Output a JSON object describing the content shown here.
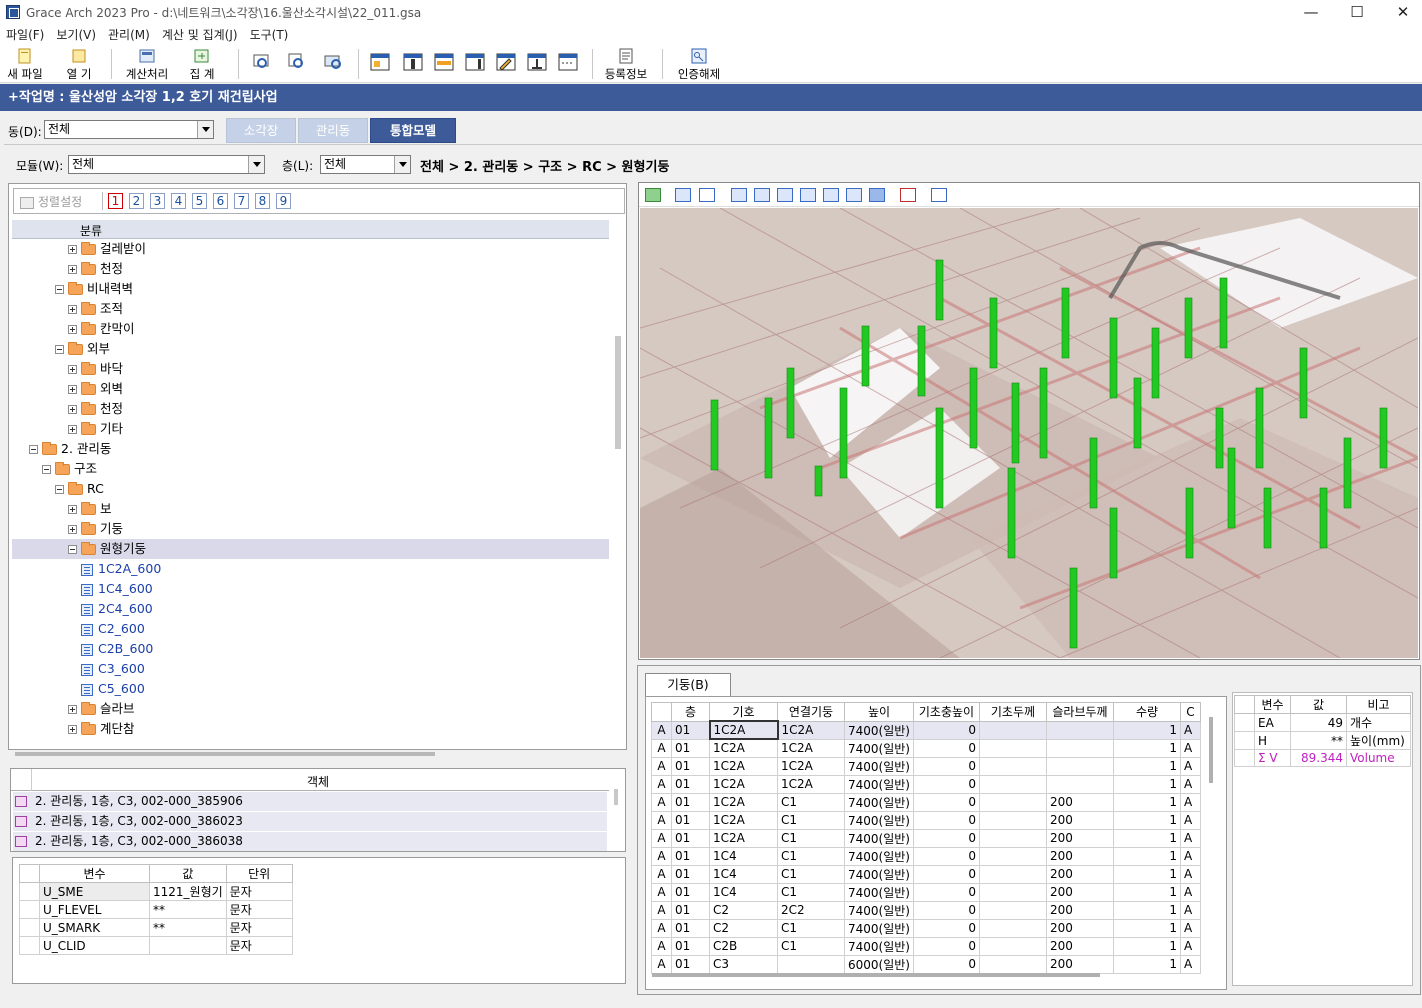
{
  "app": {
    "title": "Grace Arch 2023 Pro - d:\\네트워크\\소각장\\16.울산소각시설\\22_011.gsa"
  },
  "window": {
    "minimize": "—",
    "maximize": "☐",
    "close": "✕"
  },
  "menu": [
    "파일(F)",
    "보기(V)",
    "관리(M)",
    "계산 및 집계(J)",
    "도구(T)"
  ],
  "toolbar": {
    "new": "새 파일",
    "open": "열  기",
    "calc": "계산처리",
    "aggregate": "집  계",
    "register": "등록정보",
    "unauth": "인증해제"
  },
  "project": {
    "title": "+작업명 : 울산성암 소각장 1,2 호기 재건립사업"
  },
  "building": {
    "label": "동(D):",
    "value": "전체"
  },
  "tabs": [
    "소각장",
    "관리동",
    "통합모델"
  ],
  "module": {
    "label": "모듈(W):",
    "value": "전체"
  },
  "floor": {
    "label": "층(L):",
    "value": "전체"
  },
  "breadcrumb": "전체 > 2. 관리동 > 구조 > RC > 원형기둥",
  "sort": {
    "label": "정렬설정",
    "levels": [
      "1",
      "2",
      "3",
      "4",
      "5",
      "6",
      "7",
      "8",
      "9"
    ]
  },
  "tree": {
    "header": "분류",
    "rows": [
      {
        "label": "걸레받이",
        "depth": 4,
        "type": "folder",
        "exp": "plus"
      },
      {
        "label": "천정",
        "depth": 4,
        "type": "folder",
        "exp": "plus"
      },
      {
        "label": "비내력벽",
        "depth": 3,
        "type": "folder",
        "exp": "minus"
      },
      {
        "label": "조적",
        "depth": 4,
        "type": "folder",
        "exp": "plus"
      },
      {
        "label": "칸막이",
        "depth": 4,
        "type": "folder",
        "exp": "plus"
      },
      {
        "label": "외부",
        "depth": 3,
        "type": "folder",
        "exp": "minus"
      },
      {
        "label": "바닥",
        "depth": 4,
        "type": "folder",
        "exp": "plus"
      },
      {
        "label": "외벽",
        "depth": 4,
        "type": "folder",
        "exp": "plus"
      },
      {
        "label": "천정",
        "depth": 4,
        "type": "folder",
        "exp": "plus"
      },
      {
        "label": "기타",
        "depth": 4,
        "type": "folder",
        "exp": "plus"
      },
      {
        "label": "2. 관리동",
        "depth": 1,
        "type": "folder",
        "exp": "minus"
      },
      {
        "label": "구조",
        "depth": 2,
        "type": "folder",
        "exp": "minus"
      },
      {
        "label": "RC",
        "depth": 3,
        "type": "folder",
        "exp": "minus"
      },
      {
        "label": "보",
        "depth": 4,
        "type": "folder",
        "exp": "plus"
      },
      {
        "label": "기둥",
        "depth": 4,
        "type": "folder",
        "exp": "plus"
      },
      {
        "label": "원형기둥",
        "depth": 4,
        "type": "folder",
        "exp": "minus",
        "selected": true
      },
      {
        "label": "1C2A_600",
        "depth": 5,
        "type": "leaf"
      },
      {
        "label": "1C4_600",
        "depth": 5,
        "type": "leaf"
      },
      {
        "label": "2C4_600",
        "depth": 5,
        "type": "leaf"
      },
      {
        "label": "C2_600",
        "depth": 5,
        "type": "leaf"
      },
      {
        "label": "C2B_600",
        "depth": 5,
        "type": "leaf"
      },
      {
        "label": "C3_600",
        "depth": 5,
        "type": "leaf"
      },
      {
        "label": "C5_600",
        "depth": 5,
        "type": "leaf"
      },
      {
        "label": "슬라브",
        "depth": 4,
        "type": "folder",
        "exp": "plus"
      },
      {
        "label": "계단참",
        "depth": 4,
        "type": "folder",
        "exp": "plus"
      }
    ]
  },
  "objects": {
    "header": "객체",
    "rows": [
      "2. 관리동, 1층, C3, 002-000_385906",
      "2. 관리동, 1층, C3, 002-000_386023",
      "2. 관리동, 1층, C3, 002-000_386038"
    ]
  },
  "vars": {
    "headers": [
      "변수",
      "값",
      "단위"
    ],
    "rows": [
      [
        "U_SME",
        "1121_원형기",
        "문자"
      ],
      [
        "U_FLEVEL",
        "**",
        "문자"
      ],
      [
        "U_SMARK",
        "**",
        "문자"
      ],
      [
        "U_CLID",
        "",
        "문자"
      ]
    ]
  },
  "column_tab": "기둥(B)",
  "column_table": {
    "headers": [
      "",
      "층",
      "기호",
      "연결기둥",
      "높이",
      "기초충높이",
      "기초두께",
      "슬라브두께",
      "수량",
      "C"
    ],
    "rows": [
      [
        "A",
        "01",
        "1C2A",
        "1C2A",
        "7400(일반)",
        "0",
        "",
        "",
        "1",
        "A"
      ],
      [
        "A",
        "01",
        "1C2A",
        "1C2A",
        "7400(일반)",
        "0",
        "",
        "",
        "1",
        "A"
      ],
      [
        "A",
        "01",
        "1C2A",
        "1C2A",
        "7400(일반)",
        "0",
        "",
        "",
        "1",
        "A"
      ],
      [
        "A",
        "01",
        "1C2A",
        "1C2A",
        "7400(일반)",
        "0",
        "",
        "",
        "1",
        "A"
      ],
      [
        "A",
        "01",
        "1C2A",
        "C1",
        "7400(일반)",
        "0",
        "",
        "200",
        "1",
        "A"
      ],
      [
        "A",
        "01",
        "1C2A",
        "C1",
        "7400(일반)",
        "0",
        "",
        "200",
        "1",
        "A"
      ],
      [
        "A",
        "01",
        "1C2A",
        "C1",
        "7400(일반)",
        "0",
        "",
        "200",
        "1",
        "A"
      ],
      [
        "A",
        "01",
        "1C4",
        "C1",
        "7400(일반)",
        "0",
        "",
        "200",
        "1",
        "A"
      ],
      [
        "A",
        "01",
        "1C4",
        "C1",
        "7400(일반)",
        "0",
        "",
        "200",
        "1",
        "A"
      ],
      [
        "A",
        "01",
        "1C4",
        "C1",
        "7400(일반)",
        "0",
        "",
        "200",
        "1",
        "A"
      ],
      [
        "A",
        "01",
        "C2",
        "2C2",
        "7400(일반)",
        "0",
        "",
        "200",
        "1",
        "A"
      ],
      [
        "A",
        "01",
        "C2",
        "C1",
        "7400(일반)",
        "0",
        "",
        "200",
        "1",
        "A"
      ],
      [
        "A",
        "01",
        "C2B",
        "C1",
        "7400(일반)",
        "0",
        "",
        "200",
        "1",
        "A"
      ],
      [
        "A",
        "01",
        "C3",
        "",
        "6000(일반)",
        "0",
        "",
        "200",
        "1",
        "A"
      ]
    ]
  },
  "summary": {
    "headers": [
      "변수",
      "값",
      "비고"
    ],
    "rows": [
      [
        "EA",
        "49",
        "개수"
      ],
      [
        "H",
        "**",
        "높이(mm)"
      ],
      [
        "Σ V",
        "89.344",
        "Volume"
      ]
    ]
  },
  "colors": {
    "projbar": "#3d5a99",
    "tab_on": "#3d5a99",
    "tab_off": "#c5d1e6",
    "column_green": "#22c922",
    "sigma": "#c020c0"
  }
}
